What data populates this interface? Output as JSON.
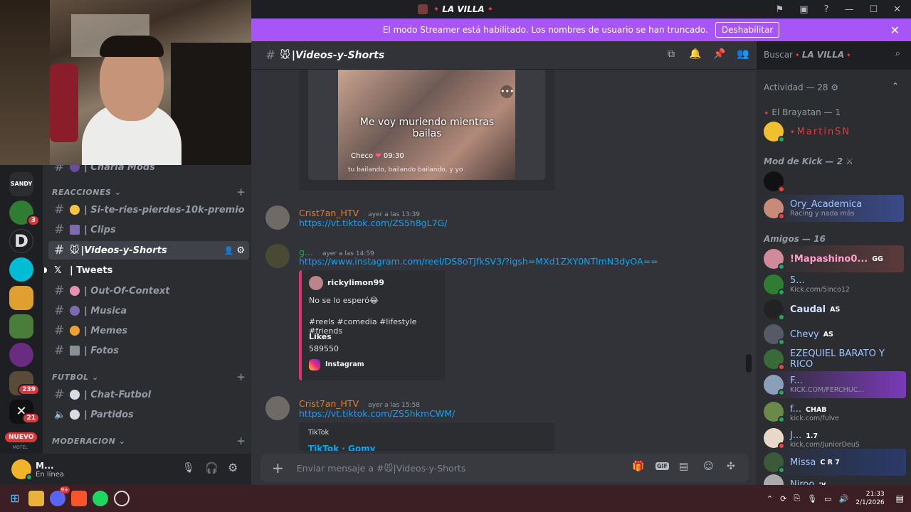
{
  "window": {
    "title": "LA VILLA"
  },
  "banner": {
    "text": "El modo Streamer está habilitado. Los nombres de usuario se han truncado.",
    "button": "Deshabilitar"
  },
  "rail": {
    "badges": [
      "3",
      "239",
      "21"
    ],
    "new_label": "NUEVO",
    "motel_label": "MOTEL",
    "sandy_label": "SANDY"
  },
  "channels": {
    "top_partial": "| Charla Mods",
    "categories": {
      "reacciones": "REACCIONES",
      "futbol": "FUTBOL",
      "moderacion": "MODERACION"
    },
    "items": [
      {
        "label": "| Si-te-ries-pierdes-10k-premio"
      },
      {
        "label": "| Clips"
      },
      {
        "label": "|Videos-y-Shorts"
      },
      {
        "label": "| Tweets"
      },
      {
        "label": "| Out-Of-Context"
      },
      {
        "label": "| Musica"
      },
      {
        "label": "| Memes"
      },
      {
        "label": "| Fotos"
      },
      {
        "label": "| Chat-Futbol"
      },
      {
        "label": "| Partidos"
      }
    ]
  },
  "user": {
    "name": "M...",
    "status": "En línea"
  },
  "header": {
    "channel": "|Videos-y-Shorts",
    "search_placeholder": "Buscar",
    "search_server": "LA VILLA"
  },
  "messages": {
    "video_caption": "Me voy muriendo mientras bailas",
    "video_sub": "tu bailando, bailando bailando, y yo",
    "video_user": "Checo",
    "video_time": "09:30",
    "m1": {
      "author": "Crist7an_HTV",
      "time": "ayer a las 13:39",
      "link": "https://vt.tiktok.com/ZS5h8gL7G/"
    },
    "m2": {
      "author": "g...",
      "time": "ayer a las 14:59",
      "link": "https://www.instagram.com/reel/DS8oTJfkSV3/?igsh=MXd1ZXY0NTlmN3dyOA==",
      "embed": {
        "author": "rickylimon99",
        "desc": "No se lo esperó😂",
        "tags": "#reels #comedia #lifestyle #friends",
        "likes_label": "Likes",
        "likes": "589550",
        "provider": "Instagram"
      }
    },
    "m3": {
      "author": "Crist7an_HTV",
      "time": "ayer a las 15:58",
      "link": "https://vt.tiktok.com/ZS5hkmCWM/",
      "embed": {
        "provider": "TikTok",
        "title": "TikTok · Gomy"
      }
    }
  },
  "composer": {
    "placeholder": "Enviar mensaje a #🐭|Videos-y-Shorts"
  },
  "members": {
    "activity": "Actividad — 28",
    "groups": [
      {
        "title": "El Brayatan — 1",
        "members": [
          {
            "name": "MartinSN",
            "sub": "",
            "tag": ""
          }
        ]
      },
      {
        "title": "Mod de Kick — 2",
        "members": [
          {
            "name": "",
            "sub": "",
            "tag": ""
          },
          {
            "name": "Ory_Academica",
            "sub": "Racing y nada más",
            "tag": ""
          }
        ]
      },
      {
        "title": "Amigos — 16",
        "members": [
          {
            "name": "!Mapashino0...",
            "sub": "",
            "tag": "GG"
          },
          {
            "name": "5...",
            "sub": "Kick.com/5inco12",
            "tag": ""
          },
          {
            "name": "Caudal",
            "sub": "",
            "tag": "AS"
          },
          {
            "name": "Chevy",
            "sub": "",
            "tag": "AS"
          },
          {
            "name": "EZEQUIEL BARATO Y RICO",
            "sub": "",
            "tag": ""
          },
          {
            "name": "F...",
            "sub": "KICK.COM/FERCHUC...",
            "tag": ""
          },
          {
            "name": "f...",
            "sub": "kick.com/fulve",
            "tag": "CHAB"
          },
          {
            "name": "J...",
            "sub": "kick.com/JuniorDeuS",
            "tag": "1.7"
          },
          {
            "name": "Missa",
            "sub": "",
            "tag": "C R 7"
          },
          {
            "name": "Niroo",
            "sub": "",
            "tag": ":v"
          }
        ]
      }
    ]
  },
  "taskbar": {
    "time": "21:33",
    "date": "2/1/2026",
    "discord_badge": "9+"
  },
  "colors": {
    "accent": "#a855f7",
    "link": "#00a8fc",
    "author": "#e67e22",
    "online": "#23a55a",
    "dnd": "#f23f43"
  }
}
